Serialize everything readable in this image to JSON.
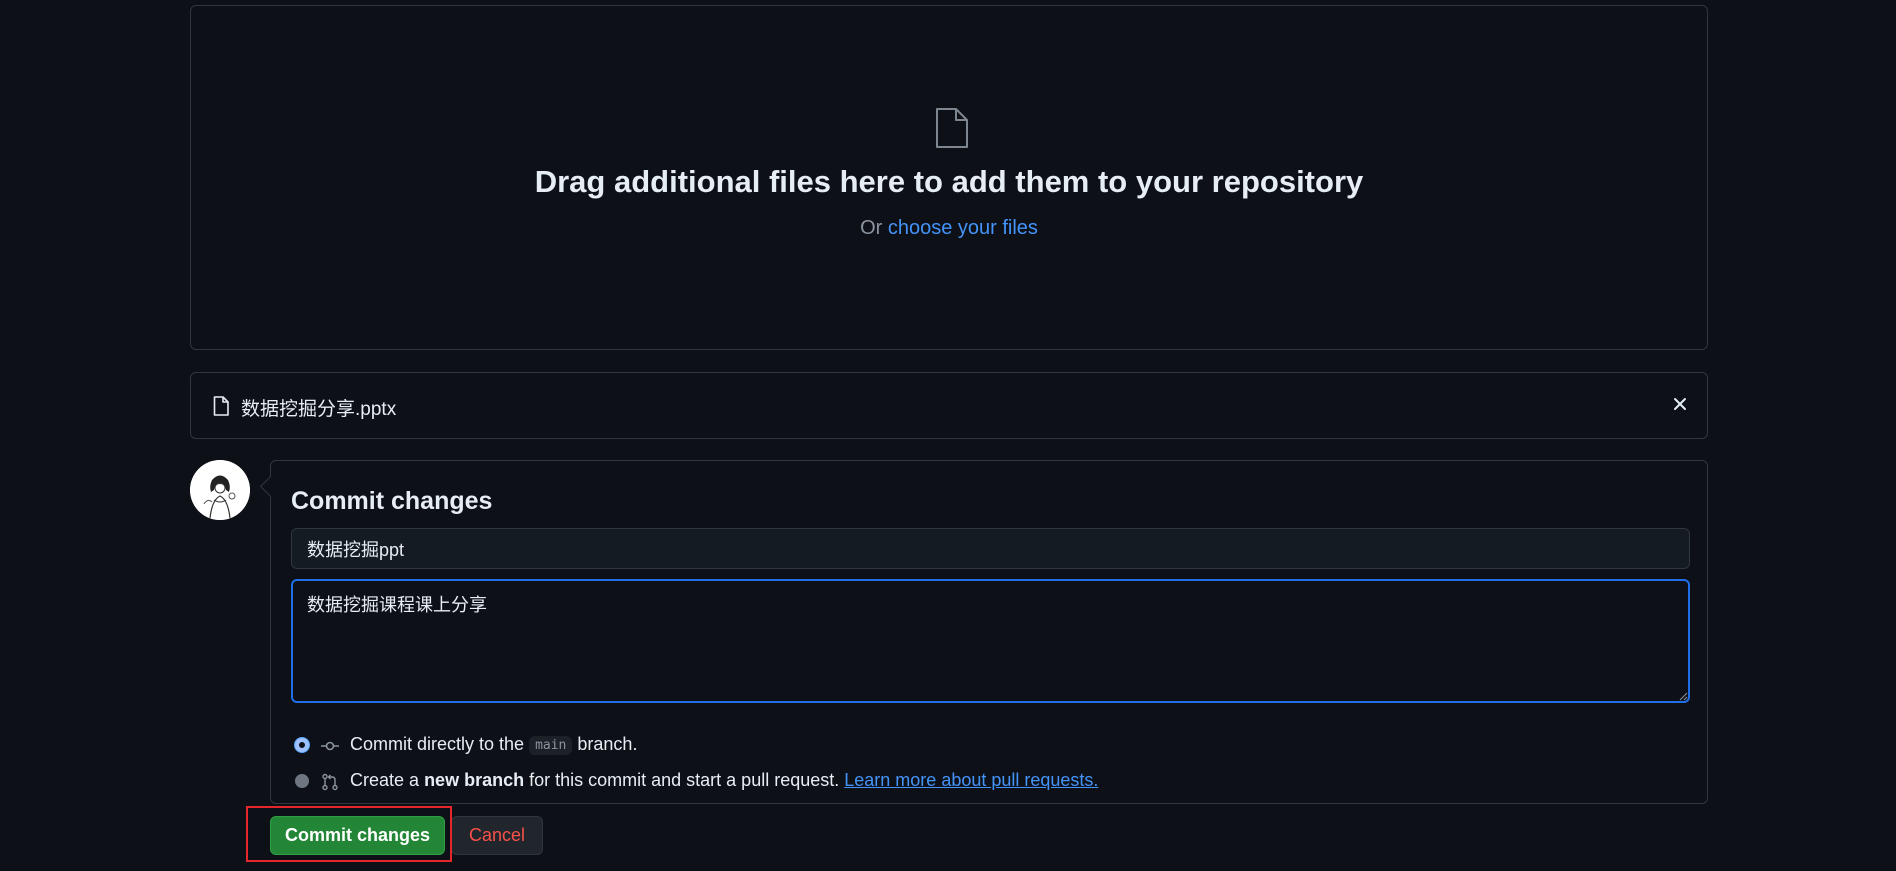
{
  "dropzone": {
    "icon": "file-icon",
    "title": "Drag additional files here to add them to your repository",
    "or_text": "Or",
    "choose_link": "choose your files"
  },
  "file": {
    "icon": "file-icon",
    "name": "数据挖掘分享.pptx",
    "remove_icon": "close-icon"
  },
  "commit": {
    "title": "Commit changes",
    "summary_value": "数据挖掘ppt",
    "description_value": "数据挖掘课程课上分享",
    "options": {
      "direct": {
        "selected": true,
        "icon": "git-commit-icon",
        "prefix": "Commit directly to the",
        "branch": "main",
        "suffix": "branch."
      },
      "new_branch": {
        "selected": false,
        "icon": "git-pull-request-icon",
        "prefix": "Create a",
        "bold": "new branch",
        "suffix": "for this commit and start a pull request.",
        "link": "Learn more about pull requests."
      }
    },
    "commit_button": "Commit changes",
    "cancel_button": "Cancel"
  },
  "colors": {
    "background": "#0d1117",
    "link": "#4493f8",
    "commit_button": "#238636",
    "cancel_text": "#f85149",
    "focus_border": "#1f6feb",
    "highlight_box": "#e5262b"
  }
}
